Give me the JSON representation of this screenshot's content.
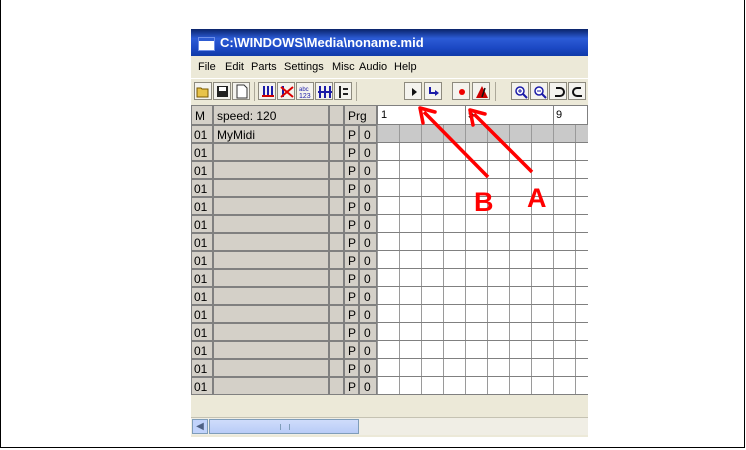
{
  "window": {
    "title": "C:\\WINDOWS\\Media\\noname.mid"
  },
  "menu": [
    "File",
    "Edit",
    "Parts",
    "Settings",
    "Misc",
    "Audio",
    "Help"
  ],
  "toolbar": {
    "buttons": [
      "open-icon",
      "save-icon",
      "new-icon",
      "notes-icon",
      "delete-notes-icon",
      "numbers-icon",
      "columns-icon",
      "bars-icon",
      "play-icon",
      "step-play-icon",
      "record-icon",
      "metronome-icon",
      "zoom-in-icon",
      "zoom-out-icon",
      "undo-icon",
      "redo-icon"
    ]
  },
  "header": {
    "m": "M",
    "speed": "speed: 120",
    "prg": "Prg",
    "ruler_labels": [
      "1",
      "5",
      "9"
    ]
  },
  "tracks": [
    {
      "num": "01",
      "name": "MyMidi",
      "p": "P",
      "prg": "0"
    },
    {
      "num": "01",
      "name": "",
      "p": "P",
      "prg": "0"
    },
    {
      "num": "01",
      "name": "",
      "p": "P",
      "prg": "0"
    },
    {
      "num": "01",
      "name": "",
      "p": "P",
      "prg": "0"
    },
    {
      "num": "01",
      "name": "",
      "p": "P",
      "prg": "0"
    },
    {
      "num": "01",
      "name": "",
      "p": "P",
      "prg": "0"
    },
    {
      "num": "01",
      "name": "",
      "p": "P",
      "prg": "0"
    },
    {
      "num": "01",
      "name": "",
      "p": "P",
      "prg": "0"
    },
    {
      "num": "01",
      "name": "",
      "p": "P",
      "prg": "0"
    },
    {
      "num": "01",
      "name": "",
      "p": "P",
      "prg": "0"
    },
    {
      "num": "01",
      "name": "",
      "p": "P",
      "prg": "0"
    },
    {
      "num": "01",
      "name": "",
      "p": "P",
      "prg": "0"
    },
    {
      "num": "01",
      "name": "",
      "p": "P",
      "prg": "0"
    },
    {
      "num": "01",
      "name": "",
      "p": "P",
      "prg": "0"
    },
    {
      "num": "01",
      "name": "",
      "p": "P",
      "prg": "0"
    }
  ],
  "annotations": {
    "label_a": "A",
    "label_b": "B",
    "color": "#ff0000"
  }
}
